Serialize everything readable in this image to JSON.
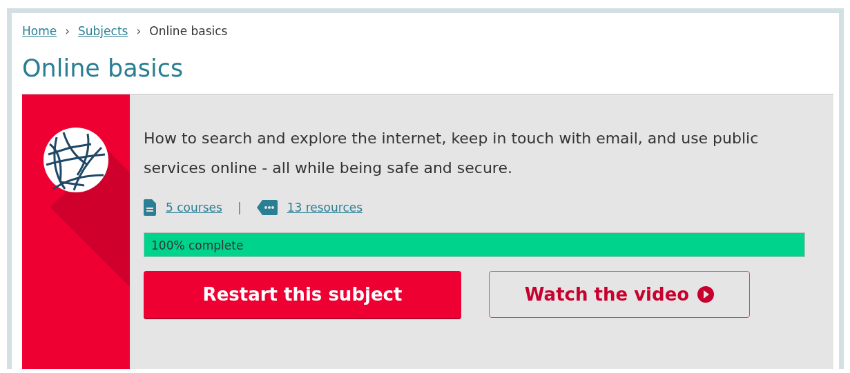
{
  "breadcrumb": [
    {
      "label": "Home",
      "link": true
    },
    {
      "label": "Subjects",
      "link": true
    },
    {
      "label": "Online basics",
      "link": false
    }
  ],
  "breadcrumb_separator": "›",
  "title": "Online basics",
  "subject": {
    "description": "How to search and explore the internet, keep in touch with email, and use public services online - all while being safe and secure.",
    "links": [
      {
        "kind": "courses",
        "label": "5 courses"
      },
      {
        "kind": "resources",
        "label": "13 resources"
      }
    ],
    "links_separator": "|",
    "progress": {
      "label": "100% complete",
      "level": 1
    },
    "buttons": [
      {
        "kind": "primary",
        "label": "Restart this subject"
      },
      {
        "kind": "video",
        "label": "Watch the video"
      }
    ]
  }
}
